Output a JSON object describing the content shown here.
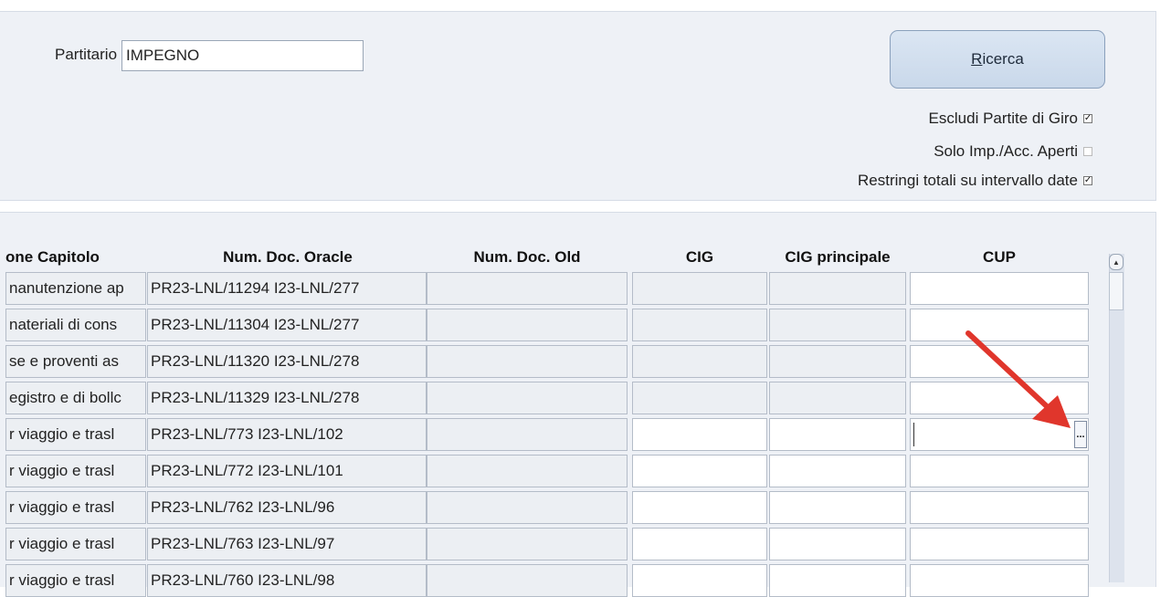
{
  "filter": {
    "partitario_label": "Partitario",
    "partitario_value": "IMPEGNO",
    "ricerca_prefix": "R",
    "ricerca_rest": "icerca",
    "options": [
      {
        "label": "Escludi Partite di Giro",
        "checked": true
      },
      {
        "label": "Solo Imp./Acc. Aperti",
        "checked": false
      },
      {
        "label": "Restringi totali su intervallo date",
        "checked": true
      }
    ]
  },
  "grid": {
    "headers": {
      "capitolo": "one Capitolo",
      "num_doc_oracle": "Num. Doc. Oracle",
      "num_doc_old": "Num. Doc. Old",
      "cig": "CIG",
      "cig_principale": "CIG principale",
      "cup": "CUP"
    },
    "rows": [
      {
        "capitolo": "nanutenzione ap",
        "oracle": "PR23-LNL/11294 I23-LNL/277",
        "old": "",
        "cig": "",
        "cig_principale": "",
        "cup": ""
      },
      {
        "capitolo": "nateriali di cons",
        "oracle": "PR23-LNL/11304 I23-LNL/277",
        "old": "",
        "cig": "",
        "cig_principale": "",
        "cup": ""
      },
      {
        "capitolo": "se e proventi as",
        "oracle": "PR23-LNL/11320 I23-LNL/278",
        "old": "",
        "cig": "",
        "cig_principale": "",
        "cup": ""
      },
      {
        "capitolo": "egistro e di bollc",
        "oracle": "PR23-LNL/11329 I23-LNL/278",
        "old": "",
        "cig": "",
        "cig_principale": "",
        "cup": ""
      },
      {
        "capitolo": "r viaggio e trasl",
        "oracle": "PR23-LNL/773 I23-LNL/102",
        "old": "",
        "cig": "",
        "cig_principale": "",
        "cup": ""
      },
      {
        "capitolo": "r viaggio e trasl",
        "oracle": "PR23-LNL/772 I23-LNL/101",
        "old": "",
        "cig": "",
        "cig_principale": "",
        "cup": ""
      },
      {
        "capitolo": "r viaggio e trasl",
        "oracle": "PR23-LNL/762 I23-LNL/96",
        "old": "",
        "cig": "",
        "cig_principale": "",
        "cup": ""
      },
      {
        "capitolo": "r viaggio e trasl",
        "oracle": "PR23-LNL/763 I23-LNL/97",
        "old": "",
        "cig": "",
        "cig_principale": "",
        "cup": ""
      },
      {
        "capitolo": "r viaggio e trasl",
        "oracle": "PR23-LNL/760 I23-LNL/98",
        "old": "",
        "cig": "",
        "cig_principale": "",
        "cup": ""
      }
    ],
    "lov_button_label": "...",
    "accent_arrow_color": "#e0362c"
  }
}
